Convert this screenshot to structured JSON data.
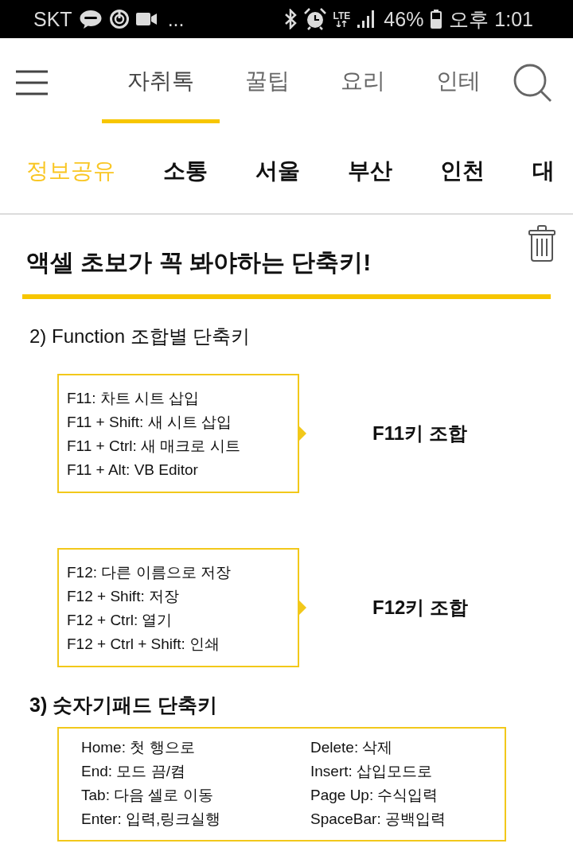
{
  "status_bar": {
    "carrier": "SKT",
    "overflow": "...",
    "network": "LTE",
    "battery": "46%",
    "time": "오후 1:01"
  },
  "top_tabs": [
    {
      "label": "자취톡",
      "selected": true
    },
    {
      "label": "꿀팁",
      "selected": false
    },
    {
      "label": "요리",
      "selected": false
    },
    {
      "label": "인테",
      "selected": false
    }
  ],
  "categories": [
    {
      "label": "정보공유",
      "selected": true
    },
    {
      "label": "소통",
      "selected": false
    },
    {
      "label": "서울",
      "selected": false
    },
    {
      "label": "부산",
      "selected": false
    },
    {
      "label": "인천",
      "selected": false
    },
    {
      "label": "대",
      "selected": false
    }
  ],
  "post": {
    "title": "액셀 초보가 꼭 봐야하는 단축키!",
    "sections": [
      {
        "kind": "callouts",
        "heading": "2) Function 조합별 단축키",
        "groups": [
          {
            "lines": [
              "F11: 차트 시트 삽입",
              "F11 + Shift: 새 시트 삽입",
              "F11 + Ctrl: 새 매크로 시트",
              "F11 + Alt: VB Editor"
            ],
            "label": "F11키 조합"
          },
          {
            "lines": [
              "F12: 다른 이름으로 저장",
              "F12 + Shift: 저장",
              "F12 + Ctrl: 열기",
              "F12 + Ctrl + Shift: 인쇄"
            ],
            "label": "F12키 조합"
          }
        ]
      },
      {
        "kind": "table",
        "heading": "3) 숫자기패드 단축키",
        "columns": [
          [
            "Home: 첫 행으로",
            "End: 모드 끔/켬",
            "Tab: 다음 셀로 이동",
            "Enter: 입력,링크실행"
          ],
          [
            "Delete: 삭제",
            "Insert: 삽입모드로",
            "Page Up: 수식입력",
            "SpaceBar: 공백입력"
          ]
        ]
      }
    ]
  }
}
